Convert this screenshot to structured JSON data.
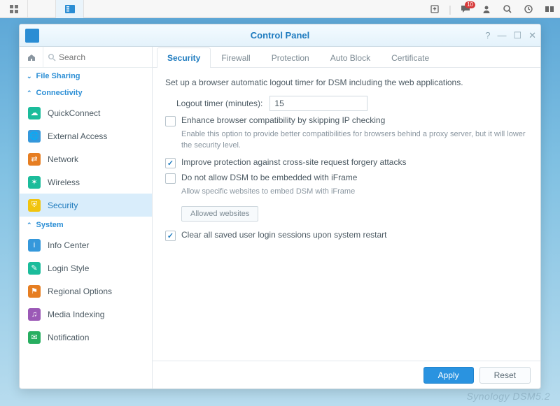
{
  "topbar": {
    "notification_count": "10"
  },
  "window": {
    "title": "Control Panel"
  },
  "search": {
    "placeholder": "Search"
  },
  "groups": {
    "file_sharing": "File Sharing",
    "connectivity": "Connectivity",
    "system": "System"
  },
  "sidebar": {
    "quickconnect": "QuickConnect",
    "external_access": "External Access",
    "network": "Network",
    "wireless": "Wireless",
    "security": "Security",
    "info_center": "Info Center",
    "login_style": "Login Style",
    "regional_options": "Regional Options",
    "media_indexing": "Media Indexing",
    "notification": "Notification"
  },
  "tabs": {
    "security": "Security",
    "firewall": "Firewall",
    "protection": "Protection",
    "auto_block": "Auto Block",
    "certificate": "Certificate"
  },
  "panel": {
    "intro": "Set up a browser automatic logout timer for DSM including the web applications.",
    "logout_label": "Logout timer (minutes):",
    "logout_value": "15",
    "enhance_compat": "Enhance browser compatibility by skipping IP checking",
    "enhance_hint": "Enable this option to provide better compatibilities for browsers behind a proxy server, but it will lower the security level.",
    "improve_csrf": "Improve protection against cross-site request forgery attacks",
    "no_iframe": "Do not allow DSM to be embedded with iFrame",
    "iframe_hint": "Allow specific websites to embed DSM with iFrame",
    "allowed_websites_btn": "Allowed websites",
    "clear_sessions": "Clear all saved user login sessions upon system restart"
  },
  "footer": {
    "apply": "Apply",
    "reset": "Reset"
  },
  "watermark": "Synology DSM5.2"
}
